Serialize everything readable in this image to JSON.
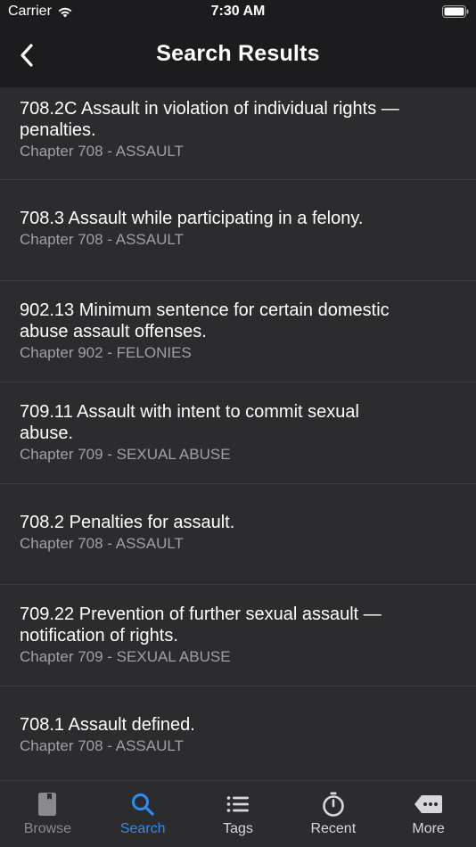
{
  "status_bar": {
    "carrier": "Carrier",
    "time": "7:30 AM"
  },
  "nav": {
    "title": "Search Results"
  },
  "results": [
    {
      "title_lines": [
        "708.2C  Assault in violation of individual rights —",
        "penalties."
      ],
      "subtitle": "Chapter 708 - ASSAULT"
    },
    {
      "title_lines": [
        "708.3  Assault while participating in a felony."
      ],
      "subtitle": "Chapter 708 - ASSAULT"
    },
    {
      "title_lines": [
        "902.13  Minimum sentence for certain domestic",
        "abuse assault offenses."
      ],
      "subtitle": "Chapter 902 - FELONIES"
    },
    {
      "title_lines": [
        "709.11  Assault with intent to commit sexual",
        "abuse."
      ],
      "subtitle": "Chapter 709 - SEXUAL ABUSE"
    },
    {
      "title_lines": [
        "708.2  Penalties for assault."
      ],
      "subtitle": "Chapter 708 - ASSAULT"
    },
    {
      "title_lines": [
        "709.22  Prevention of further sexual assault —",
        "notification of rights."
      ],
      "subtitle": "Chapter 709 - SEXUAL ABUSE"
    },
    {
      "title_lines": [
        "708.1  Assault defined."
      ],
      "subtitle": "Chapter 708 - ASSAULT"
    }
  ],
  "tabs": [
    {
      "label": "Browse",
      "icon": "book-icon",
      "state": "disabled"
    },
    {
      "label": "Search",
      "icon": "search-icon",
      "state": "selected"
    },
    {
      "label": "Tags",
      "icon": "list-icon",
      "state": "normal"
    },
    {
      "label": "Recent",
      "icon": "stopwatch-icon",
      "state": "normal"
    },
    {
      "label": "More",
      "icon": "more-icon",
      "state": "normal"
    }
  ],
  "colors": {
    "header_bg": "#1c1c1e",
    "list_bg": "#2c2c2e",
    "separator": "#3d3d40",
    "subtitle": "#a0a0a5",
    "accent": "#2f8df0",
    "tab_normal": "#d8d8dc",
    "tab_disabled": "#8a8a8e"
  }
}
